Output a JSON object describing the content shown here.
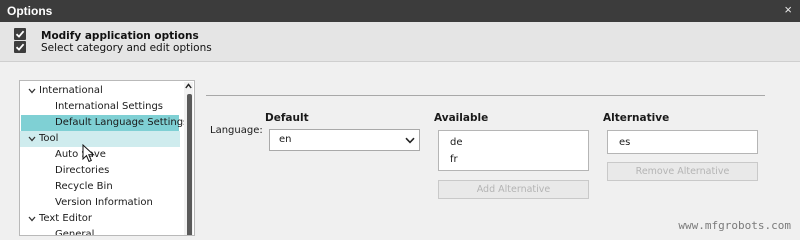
{
  "window": {
    "title": "Options",
    "close_glyph": "×"
  },
  "header": {
    "title": "Modify application options",
    "subtitle": "Select category and edit options"
  },
  "tree": {
    "items": [
      {
        "label": "International",
        "level": 0,
        "expanded": true
      },
      {
        "label": "International Settings",
        "level": 1
      },
      {
        "label": "Default Language Settings",
        "level": 1,
        "selected": true
      },
      {
        "label": "Tool",
        "level": 0,
        "expanded": true,
        "hover": true
      },
      {
        "label": "Auto Save",
        "level": 1
      },
      {
        "label": "Directories",
        "level": 1
      },
      {
        "label": "Recycle Bin",
        "level": 1
      },
      {
        "label": "Version Information",
        "level": 1
      },
      {
        "label": "Text Editor",
        "level": 0,
        "expanded": true
      },
      {
        "label": "General",
        "level": 1
      }
    ]
  },
  "language": {
    "label": "Language:",
    "default_header": "Default",
    "available_header": "Available",
    "alternative_header": "Alternative",
    "default_value": "en",
    "available": [
      "de",
      "fr"
    ],
    "alternative": [
      "es"
    ],
    "add_button": "Add Alternative",
    "remove_button": "Remove Alternative"
  },
  "colors": {
    "titlebar": "#3c3c3c",
    "selected_row": "#7fd0d4",
    "hover_row": "#cfecee",
    "disabled_text": "#b4b4b4"
  },
  "watermark": "www.mfgrobots.com"
}
